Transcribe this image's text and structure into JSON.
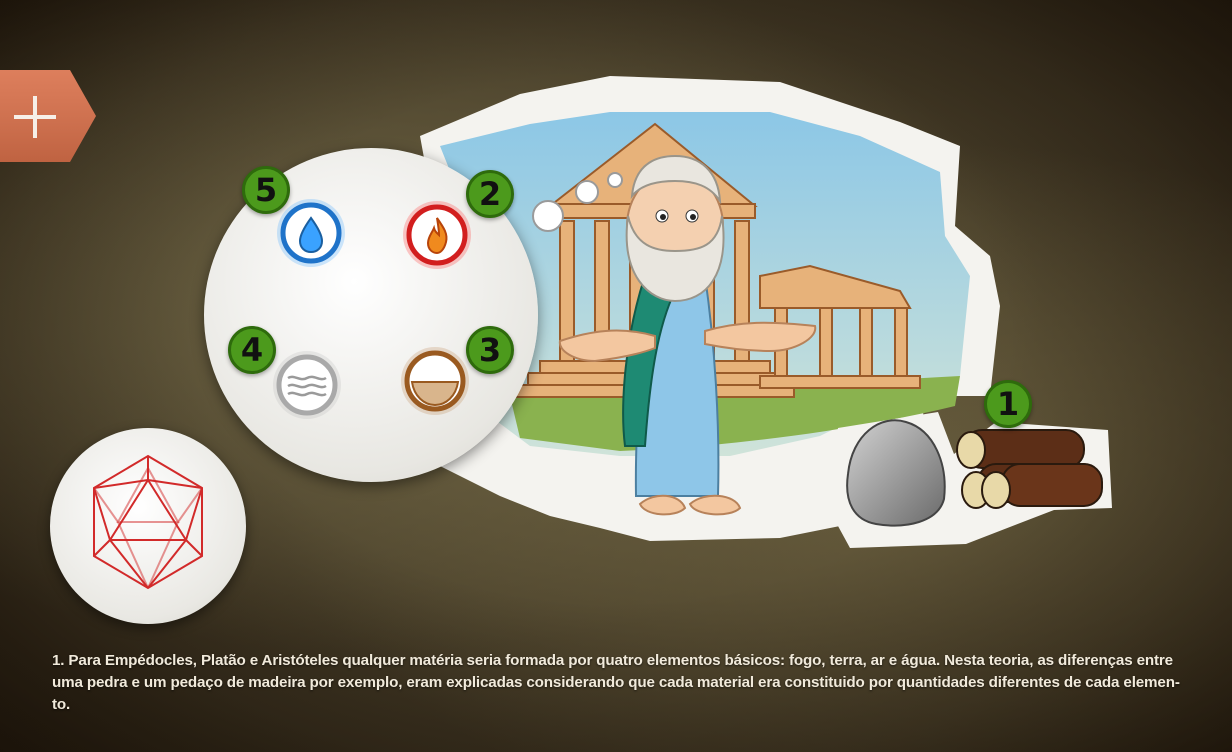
{
  "menu": {
    "icon": "plus-icon",
    "color": "#d9704a"
  },
  "scene": {
    "figure": "aristotle",
    "background": "greek-temple",
    "thought_bubbles": 3
  },
  "elements": {
    "items": [
      {
        "number": "5",
        "icon": "water-drop-icon",
        "glow": "#3aa2ff"
      },
      {
        "number": "2",
        "icon": "fire-flame-icon",
        "glow": "#ff2a2a"
      },
      {
        "number": "4",
        "icon": "air-wind-icon",
        "glow": "#b9b9b9"
      },
      {
        "number": "3",
        "icon": "earth-bowl-icon",
        "glow": "#b06a2a"
      }
    ],
    "materials_badge": "1"
  },
  "materials": {
    "stone": "stone-icon",
    "wood": "wood-logs-icon"
  },
  "polyhedron": {
    "icon": "icosahedron-icon",
    "color": "#d22a2a"
  },
  "caption": {
    "text": "1. Para Empédocles, Platão e Aristóteles qualquer matéria seria formada por quatro elementos básicos: fogo, terra, ar e água. Nesta teoria, as diferenças entre uma pedra e um pedaço de madeira por exemplo, eram explicadas considerando que cada material era constituido por quantidades diferentes de cada elemen-to."
  }
}
